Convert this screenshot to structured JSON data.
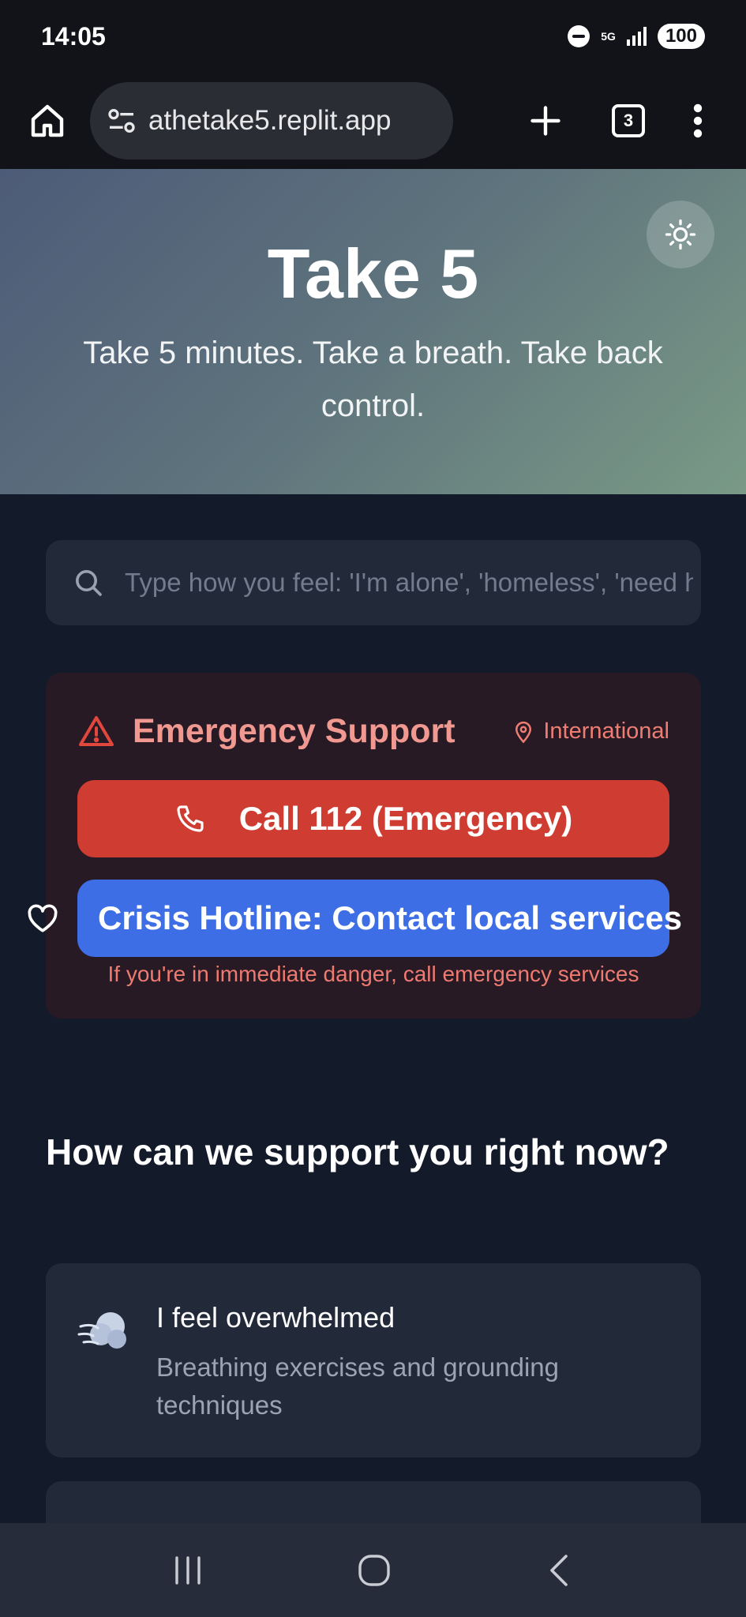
{
  "status_bar": {
    "time": "14:05",
    "network": "5G",
    "battery": "100"
  },
  "browser": {
    "url": "athetake5.replit.app",
    "tab_count": "3"
  },
  "hero": {
    "title": "Take 5",
    "subtitle": "Take 5 minutes. Take a breath. Take back control."
  },
  "search": {
    "placeholder": "Type how you feel: 'I'm alone', 'homeless', 'need help'"
  },
  "emergency": {
    "title": "Emergency Support",
    "location": "International",
    "call_label": "Call 112 (Emergency)",
    "hotline_label": "Crisis Hotline: Contact local services",
    "note": "If you're in immediate danger, call emergency services"
  },
  "support": {
    "title": "How can we support you right now?",
    "options": [
      {
        "title": "I feel overwhelmed",
        "description": "Breathing exercises and grounding techniques"
      }
    ]
  },
  "colors": {
    "emergency_red": "#cf3c31",
    "hotline_blue": "#3d6ee6",
    "background": "#131a2a",
    "card": "#222a3a"
  }
}
